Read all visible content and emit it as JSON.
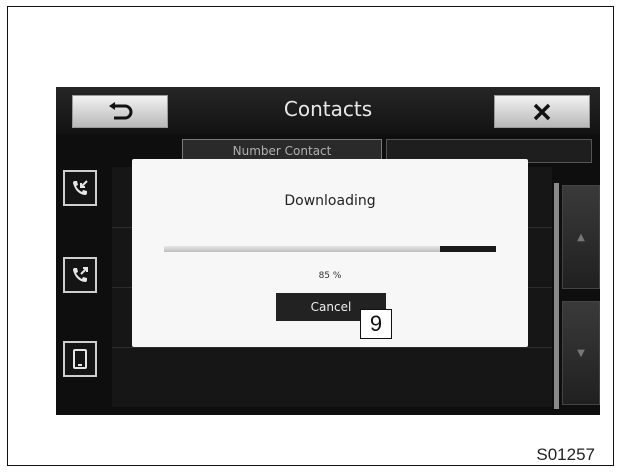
{
  "header": {
    "title": "Contacts"
  },
  "background": {
    "tab_label": "Number Contact"
  },
  "dialog": {
    "title": "Downloading",
    "progress_fraction": 0.83,
    "progress_text": "85 %",
    "cancel_label": "Cancel"
  },
  "callout_number": "9",
  "figure_code": "S01257",
  "icons": {
    "back": "return-arrow-icon",
    "close": "close-x-icon",
    "side": [
      "incoming-call-icon",
      "outgoing-call-icon",
      "phone-device-icon"
    ]
  },
  "colors": {
    "screen_bg": "#0e0e0e",
    "dialog_bg": "#f7f7f7",
    "button_dark": "#222222"
  }
}
